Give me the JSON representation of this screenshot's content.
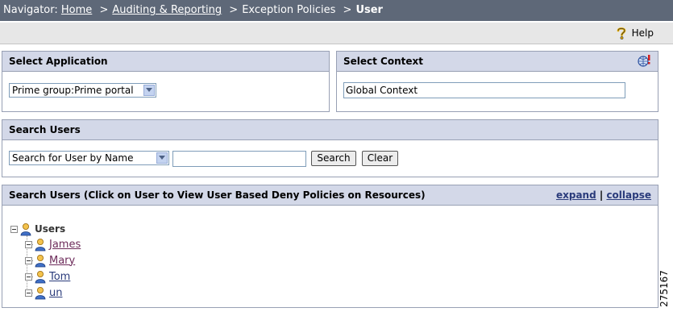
{
  "navigator": {
    "label": "Navigator:",
    "crumbs": [
      "Home",
      "Auditing & Reporting",
      "Exception Policies"
    ],
    "separator": ">",
    "current": "User"
  },
  "toolbar": {
    "help_label": "Help",
    "help_icon": "question-mark-icon"
  },
  "select_application": {
    "title": "Select Application",
    "selected": "Prime group:Prime portal"
  },
  "select_context": {
    "title": "Select Context",
    "value": "Global Context",
    "icon": "globe-alert-icon"
  },
  "search_users": {
    "title": "Search Users",
    "search_type": "Search for User by Name",
    "query": "",
    "search_button": "Search",
    "clear_button": "Clear"
  },
  "results": {
    "title": "Search Users (Click on User to View User Based Deny Policies on Resources)",
    "expand": "expand",
    "divider": "|",
    "collapse": "collapse",
    "root": "Users",
    "users": [
      "James",
      "Mary",
      "Tom",
      "un"
    ]
  },
  "figure_id": "275167",
  "colors": {
    "navbar_bg": "#5e6878",
    "panel_header_bg": "#d3d8e8",
    "link_visited": "#6d2b5a",
    "link_action": "#2a3b7b"
  }
}
